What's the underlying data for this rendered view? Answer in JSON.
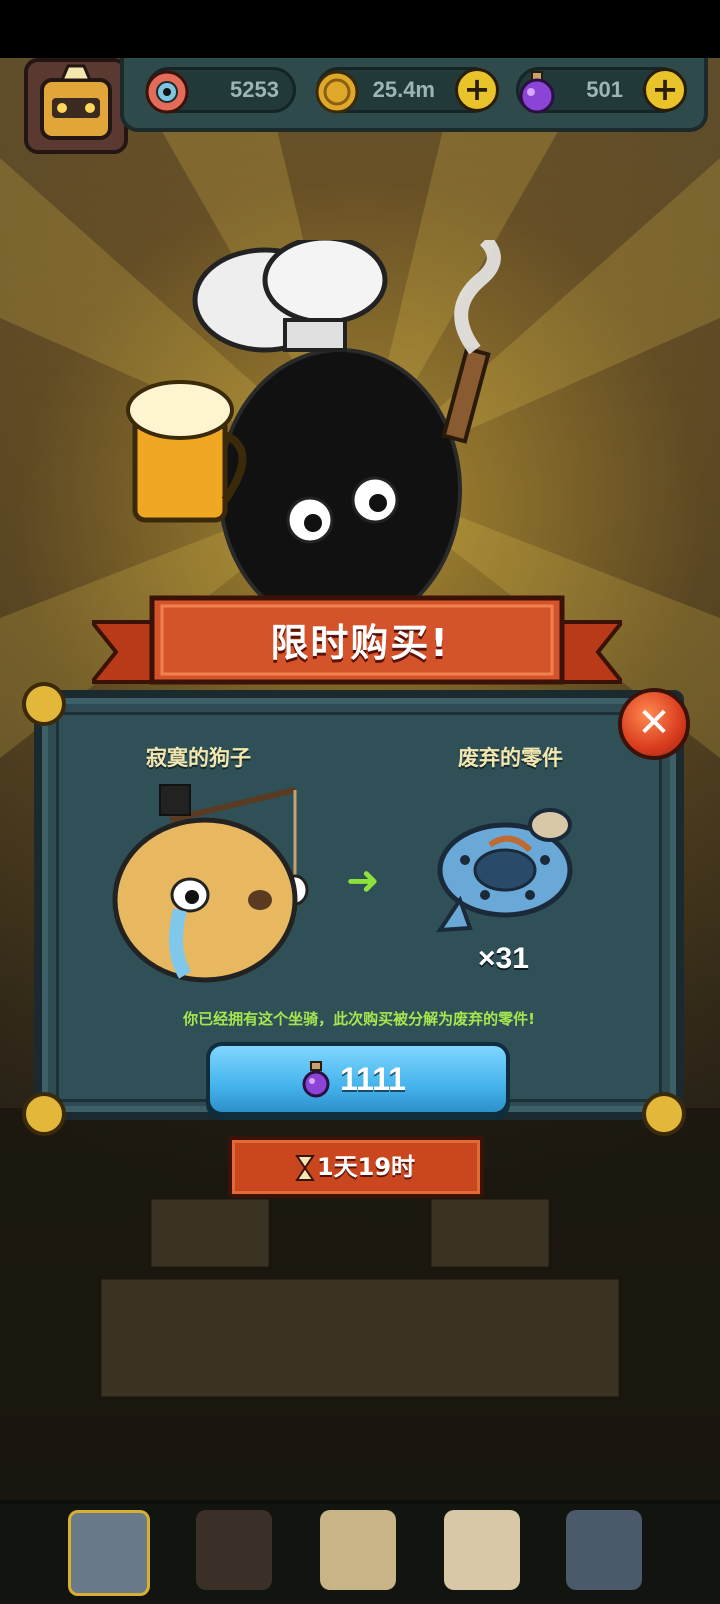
{
  "resources": {
    "eye_count": "5253",
    "coin_count": "25.4m",
    "potion_count": "501",
    "plus_label": "+"
  },
  "offer": {
    "title": "限时购买!",
    "item_left_name": "寂寞的狗子",
    "item_right_name": "废弃的零件",
    "quantity": "×31",
    "notice": "你已经拥有这个坐骑，此次购买被分解为废弃的零件!",
    "price": "1111",
    "timer": "1天19时",
    "close_label": "✕",
    "arrow": "➜"
  },
  "colors": {
    "banner_red": "#c9461f",
    "panel_teal": "#2e4a52",
    "buy_blue": "#45b4ec",
    "notice_green": "#a5e64e",
    "gold": "#e3b83a"
  },
  "icons": [
    "eye-icon",
    "coin-icon",
    "potion-icon",
    "plus-icon",
    "close-icon",
    "hourglass-icon",
    "arrow-right-icon"
  ]
}
